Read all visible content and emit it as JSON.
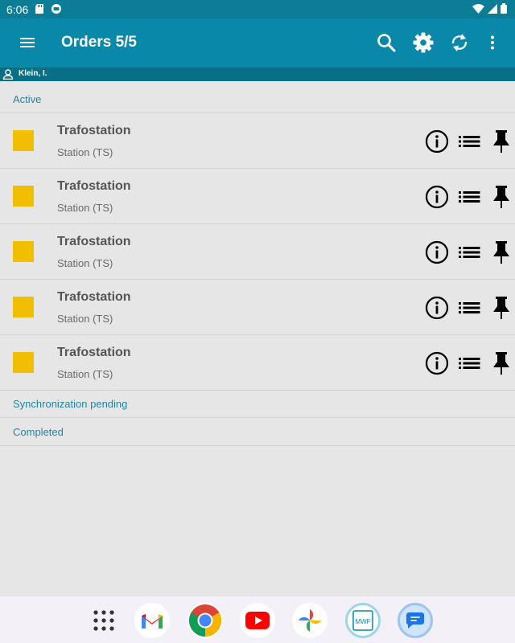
{
  "status_bar": {
    "time": "6:06"
  },
  "app_bar": {
    "title": "Orders 5/5"
  },
  "user": {
    "name": "Klein, I."
  },
  "sections": {
    "active": "Active",
    "sync_pending": "Synchronization pending",
    "completed": "Completed"
  },
  "orders": [
    {
      "name": "Trafostation",
      "type": "Station (TS)"
    },
    {
      "name": "Trafostation",
      "type": "Station (TS)"
    },
    {
      "name": "Trafostation",
      "type": "Station (TS)"
    },
    {
      "name": "Trafostation",
      "type": "Station (TS)"
    },
    {
      "name": "Trafostation",
      "type": "Station (TS)"
    }
  ],
  "colors": {
    "appbar": "#0a88aa",
    "status": "#f1bf00",
    "section_text": "#1f86a6"
  },
  "dock_apps": {
    "calendar_label": "MWF"
  }
}
